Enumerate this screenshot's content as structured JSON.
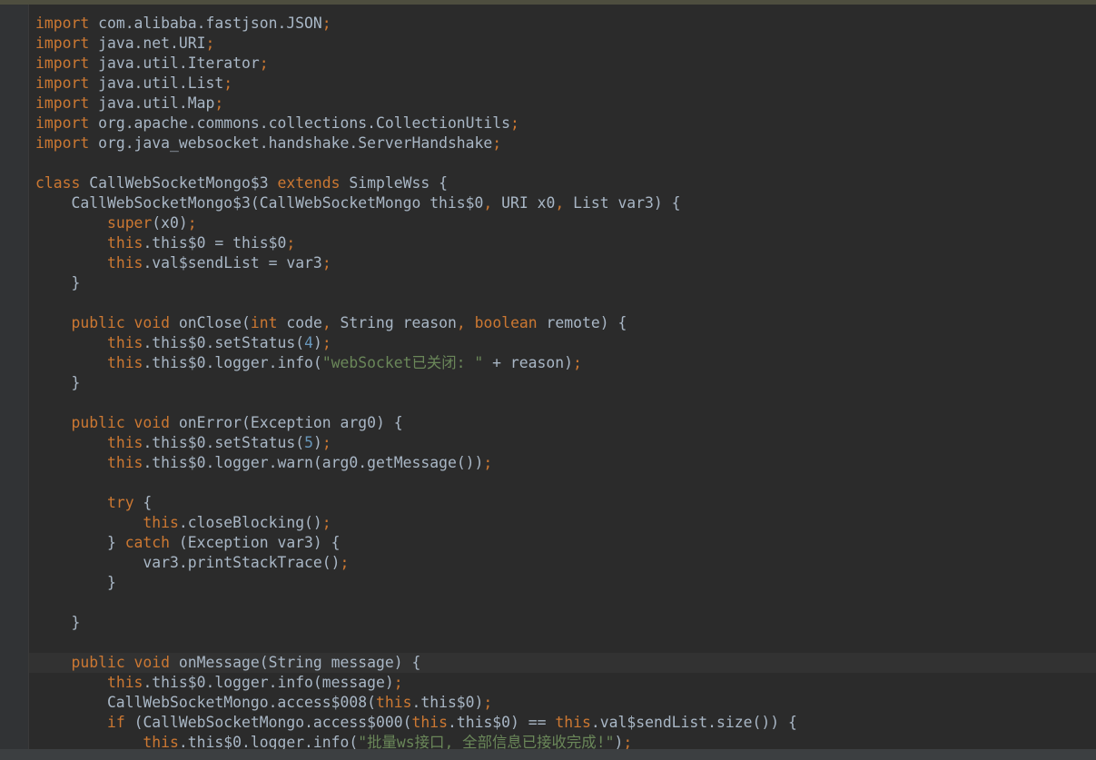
{
  "theme": {
    "background": "#2b2b2b",
    "keyword_color": "#cc7832",
    "default_text_color": "#a9b7c6",
    "number_color": "#6897bb",
    "string_color": "#6a8759"
  },
  "code_lines": [
    {
      "tokens": [
        {
          "t": "kw",
          "v": "import"
        },
        {
          "t": "plain",
          "v": " com.alibaba.fastjson.JSON"
        },
        {
          "t": "semi",
          "v": ";"
        }
      ]
    },
    {
      "tokens": [
        {
          "t": "kw",
          "v": "import"
        },
        {
          "t": "plain",
          "v": " java.net.URI"
        },
        {
          "t": "semi",
          "v": ";"
        }
      ]
    },
    {
      "tokens": [
        {
          "t": "kw",
          "v": "import"
        },
        {
          "t": "plain",
          "v": " java.util.Iterator"
        },
        {
          "t": "semi",
          "v": ";"
        }
      ]
    },
    {
      "tokens": [
        {
          "t": "kw",
          "v": "import"
        },
        {
          "t": "plain",
          "v": " java.util.List"
        },
        {
          "t": "semi",
          "v": ";"
        }
      ]
    },
    {
      "tokens": [
        {
          "t": "kw",
          "v": "import"
        },
        {
          "t": "plain",
          "v": " java.util.Map"
        },
        {
          "t": "semi",
          "v": ";"
        }
      ]
    },
    {
      "tokens": [
        {
          "t": "kw",
          "v": "import"
        },
        {
          "t": "plain",
          "v": " org.apache.commons.collections.CollectionUtils"
        },
        {
          "t": "semi",
          "v": ";"
        }
      ]
    },
    {
      "tokens": [
        {
          "t": "kw",
          "v": "import"
        },
        {
          "t": "plain",
          "v": " org.java_websocket.handshake.ServerHandshake"
        },
        {
          "t": "semi",
          "v": ";"
        }
      ]
    },
    {
      "tokens": []
    },
    {
      "tokens": [
        {
          "t": "kw",
          "v": "class"
        },
        {
          "t": "plain",
          "v": " CallWebSocketMongo$3 "
        },
        {
          "t": "kw",
          "v": "extends"
        },
        {
          "t": "plain",
          "v": " SimpleWss {"
        }
      ]
    },
    {
      "tokens": [
        {
          "t": "plain",
          "v": "    CallWebSocketMongo$3(CallWebSocketMongo this$0"
        },
        {
          "t": "semi",
          "v": ","
        },
        {
          "t": "plain",
          "v": " URI x0"
        },
        {
          "t": "semi",
          "v": ","
        },
        {
          "t": "plain",
          "v": " List var3) {"
        }
      ]
    },
    {
      "tokens": [
        {
          "t": "plain",
          "v": "        "
        },
        {
          "t": "kw",
          "v": "super"
        },
        {
          "t": "plain",
          "v": "(x0)"
        },
        {
          "t": "semi",
          "v": ";"
        }
      ]
    },
    {
      "tokens": [
        {
          "t": "plain",
          "v": "        "
        },
        {
          "t": "kw",
          "v": "this"
        },
        {
          "t": "plain",
          "v": ".this$0 = this$0"
        },
        {
          "t": "semi",
          "v": ";"
        }
      ]
    },
    {
      "tokens": [
        {
          "t": "plain",
          "v": "        "
        },
        {
          "t": "kw",
          "v": "this"
        },
        {
          "t": "plain",
          "v": ".val$sendList = var3"
        },
        {
          "t": "semi",
          "v": ";"
        }
      ]
    },
    {
      "tokens": [
        {
          "t": "plain",
          "v": "    }"
        }
      ]
    },
    {
      "tokens": []
    },
    {
      "tokens": [
        {
          "t": "plain",
          "v": "    "
        },
        {
          "t": "kw",
          "v": "public void"
        },
        {
          "t": "plain",
          "v": " onClose("
        },
        {
          "t": "kw",
          "v": "int"
        },
        {
          "t": "plain",
          "v": " code"
        },
        {
          "t": "semi",
          "v": ","
        },
        {
          "t": "plain",
          "v": " String reason"
        },
        {
          "t": "semi",
          "v": ","
        },
        {
          "t": "plain",
          "v": " "
        },
        {
          "t": "kw",
          "v": "boolean"
        },
        {
          "t": "plain",
          "v": " remote) {"
        }
      ]
    },
    {
      "tokens": [
        {
          "t": "plain",
          "v": "        "
        },
        {
          "t": "kw",
          "v": "this"
        },
        {
          "t": "plain",
          "v": ".this$0.setStatus("
        },
        {
          "t": "num",
          "v": "4"
        },
        {
          "t": "plain",
          "v": ")"
        },
        {
          "t": "semi",
          "v": ";"
        }
      ]
    },
    {
      "tokens": [
        {
          "t": "plain",
          "v": "        "
        },
        {
          "t": "kw",
          "v": "this"
        },
        {
          "t": "plain",
          "v": ".this$0.logger.info("
        },
        {
          "t": "str",
          "v": "\"webSocket已关闭: \""
        },
        {
          "t": "plain",
          "v": " + reason)"
        },
        {
          "t": "semi",
          "v": ";"
        }
      ]
    },
    {
      "tokens": [
        {
          "t": "plain",
          "v": "    }"
        }
      ]
    },
    {
      "tokens": []
    },
    {
      "tokens": [
        {
          "t": "plain",
          "v": "    "
        },
        {
          "t": "kw",
          "v": "public void"
        },
        {
          "t": "plain",
          "v": " onError(Exception arg0) {"
        }
      ]
    },
    {
      "tokens": [
        {
          "t": "plain",
          "v": "        "
        },
        {
          "t": "kw",
          "v": "this"
        },
        {
          "t": "plain",
          "v": ".this$0.setStatus("
        },
        {
          "t": "num",
          "v": "5"
        },
        {
          "t": "plain",
          "v": ")"
        },
        {
          "t": "semi",
          "v": ";"
        }
      ]
    },
    {
      "tokens": [
        {
          "t": "plain",
          "v": "        "
        },
        {
          "t": "kw",
          "v": "this"
        },
        {
          "t": "plain",
          "v": ".this$0.logger.warn(arg0.getMessage())"
        },
        {
          "t": "semi",
          "v": ";"
        }
      ]
    },
    {
      "tokens": []
    },
    {
      "tokens": [
        {
          "t": "plain",
          "v": "        "
        },
        {
          "t": "kw",
          "v": "try"
        },
        {
          "t": "plain",
          "v": " {"
        }
      ]
    },
    {
      "tokens": [
        {
          "t": "plain",
          "v": "            "
        },
        {
          "t": "kw",
          "v": "this"
        },
        {
          "t": "plain",
          "v": ".closeBlocking()"
        },
        {
          "t": "semi",
          "v": ";"
        }
      ]
    },
    {
      "tokens": [
        {
          "t": "plain",
          "v": "        } "
        },
        {
          "t": "kw",
          "v": "catch"
        },
        {
          "t": "plain",
          "v": " (Exception var3) {"
        }
      ]
    },
    {
      "tokens": [
        {
          "t": "plain",
          "v": "            var3.printStackTrace()"
        },
        {
          "t": "semi",
          "v": ";"
        }
      ]
    },
    {
      "tokens": [
        {
          "t": "plain",
          "v": "        }"
        }
      ]
    },
    {
      "tokens": []
    },
    {
      "tokens": [
        {
          "t": "plain",
          "v": "    }"
        }
      ]
    },
    {
      "tokens": []
    },
    {
      "caret": true,
      "tokens": [
        {
          "t": "plain",
          "v": "    "
        },
        {
          "t": "kw",
          "v": "public void"
        },
        {
          "t": "plain",
          "v": " onMessage(String message) {"
        }
      ]
    },
    {
      "tokens": [
        {
          "t": "plain",
          "v": "        "
        },
        {
          "t": "kw",
          "v": "this"
        },
        {
          "t": "plain",
          "v": ".this$0.logger.info(message)"
        },
        {
          "t": "semi",
          "v": ";"
        }
      ]
    },
    {
      "tokens": [
        {
          "t": "plain",
          "v": "        CallWebSocketMongo.access$008("
        },
        {
          "t": "kw",
          "v": "this"
        },
        {
          "t": "plain",
          "v": ".this$0)"
        },
        {
          "t": "semi",
          "v": ";"
        }
      ]
    },
    {
      "tokens": [
        {
          "t": "plain",
          "v": "        "
        },
        {
          "t": "kw",
          "v": "if"
        },
        {
          "t": "plain",
          "v": " (CallWebSocketMongo.access$000("
        },
        {
          "t": "kw",
          "v": "this"
        },
        {
          "t": "plain",
          "v": ".this$0) == "
        },
        {
          "t": "kw",
          "v": "this"
        },
        {
          "t": "plain",
          "v": ".val$sendList.size()) {"
        }
      ]
    },
    {
      "tokens": [
        {
          "t": "plain",
          "v": "            "
        },
        {
          "t": "kw",
          "v": "this"
        },
        {
          "t": "plain",
          "v": ".this$0.logger.info("
        },
        {
          "t": "str",
          "v": "\"批量ws接口, 全部信息已接收完成!\""
        },
        {
          "t": "plain",
          "v": ")"
        },
        {
          "t": "semi",
          "v": ";"
        }
      ]
    }
  ]
}
